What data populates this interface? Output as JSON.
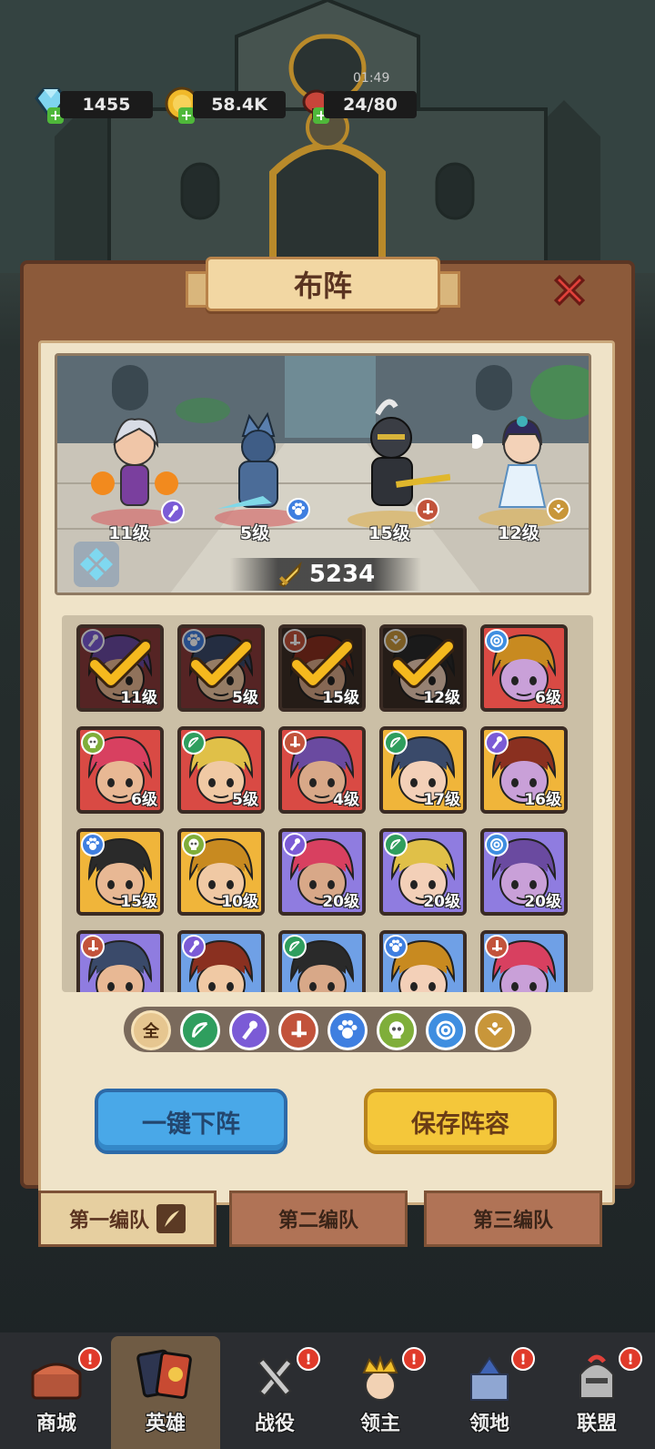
{
  "resources": {
    "gems": "1455",
    "gold": "58.4K",
    "stamina": "24/80",
    "timer": "01:49"
  },
  "panel": {
    "title": "布阵",
    "close_icon": "close-x-icon"
  },
  "lineup": {
    "power_icon": "sword-power-icon",
    "power": "5234",
    "heroes": [
      {
        "level": "11级",
        "class": "mage",
        "color": "#7b5bd6"
      },
      {
        "level": "5级",
        "class": "beast",
        "color": "#3f7fe0"
      },
      {
        "level": "15级",
        "class": "warrior",
        "color": "#c2533b"
      },
      {
        "level": "12级",
        "class": "support",
        "color": "#c8963a"
      }
    ]
  },
  "roster": [
    {
      "level": "11级",
      "class": "mage",
      "selected": true,
      "bg": "#8a3a3a"
    },
    {
      "level": "5级",
      "class": "beast",
      "selected": true,
      "bg": "#8a3a3a"
    },
    {
      "level": "15级",
      "class": "warrior",
      "selected": true,
      "bg": "#3c2e26"
    },
    {
      "level": "12级",
      "class": "support",
      "selected": true,
      "bg": "#3c2e26"
    },
    {
      "level": "6级",
      "class": "spiral",
      "selected": false,
      "bg": "#d94a44"
    },
    {
      "level": "6级",
      "class": "skull",
      "selected": false,
      "bg": "#d94a44"
    },
    {
      "level": "5级",
      "class": "ranger",
      "selected": false,
      "bg": "#d94a44"
    },
    {
      "level": "4级",
      "class": "warrior",
      "selected": false,
      "bg": "#d94a44"
    },
    {
      "level": "17级",
      "class": "ranger",
      "selected": false,
      "bg": "#f0b53a"
    },
    {
      "level": "16级",
      "class": "mage",
      "selected": false,
      "bg": "#f0b53a"
    },
    {
      "level": "15级",
      "class": "beast",
      "selected": false,
      "bg": "#f0b53a"
    },
    {
      "level": "10级",
      "class": "skull",
      "selected": false,
      "bg": "#f0b53a"
    },
    {
      "level": "20级",
      "class": "mage",
      "selected": false,
      "bg": "#8f7ce0"
    },
    {
      "level": "20级",
      "class": "ranger",
      "selected": false,
      "bg": "#8f7ce0"
    },
    {
      "level": "20级",
      "class": "spiral",
      "selected": false,
      "bg": "#8f7ce0"
    },
    {
      "level": "",
      "class": "warrior",
      "selected": false,
      "bg": "#8f7ce0"
    },
    {
      "level": "",
      "class": "mage",
      "selected": false,
      "bg": "#6fa0e6"
    },
    {
      "level": "",
      "class": "ranger",
      "selected": false,
      "bg": "#6fa0e6"
    },
    {
      "level": "",
      "class": "beast",
      "selected": false,
      "bg": "#6fa0e6"
    },
    {
      "level": "",
      "class": "warrior",
      "selected": false,
      "bg": "#6fa0e6"
    }
  ],
  "class_colors": {
    "mage": "#7b5bd6",
    "beast": "#3f7fe0",
    "warrior": "#c2533b",
    "support": "#c8963a",
    "spiral": "#3f8ee0",
    "skull": "#7fae3a",
    "ranger": "#2f9e5e"
  },
  "filters": {
    "all_label": "全",
    "items": [
      "all",
      "ranger",
      "mage",
      "warrior",
      "beast",
      "skull",
      "spiral",
      "support"
    ]
  },
  "actions": {
    "unequip_all": "一键下阵",
    "save_lineup": "保存阵容"
  },
  "teams": {
    "team1": "第一编队",
    "team2": "第二编队",
    "team3": "第三编队"
  },
  "nav": {
    "shop": "商城",
    "heroes": "英雄",
    "campaign": "战役",
    "lord": "领主",
    "territory": "领地",
    "alliance": "联盟",
    "alert_mark": "!"
  }
}
